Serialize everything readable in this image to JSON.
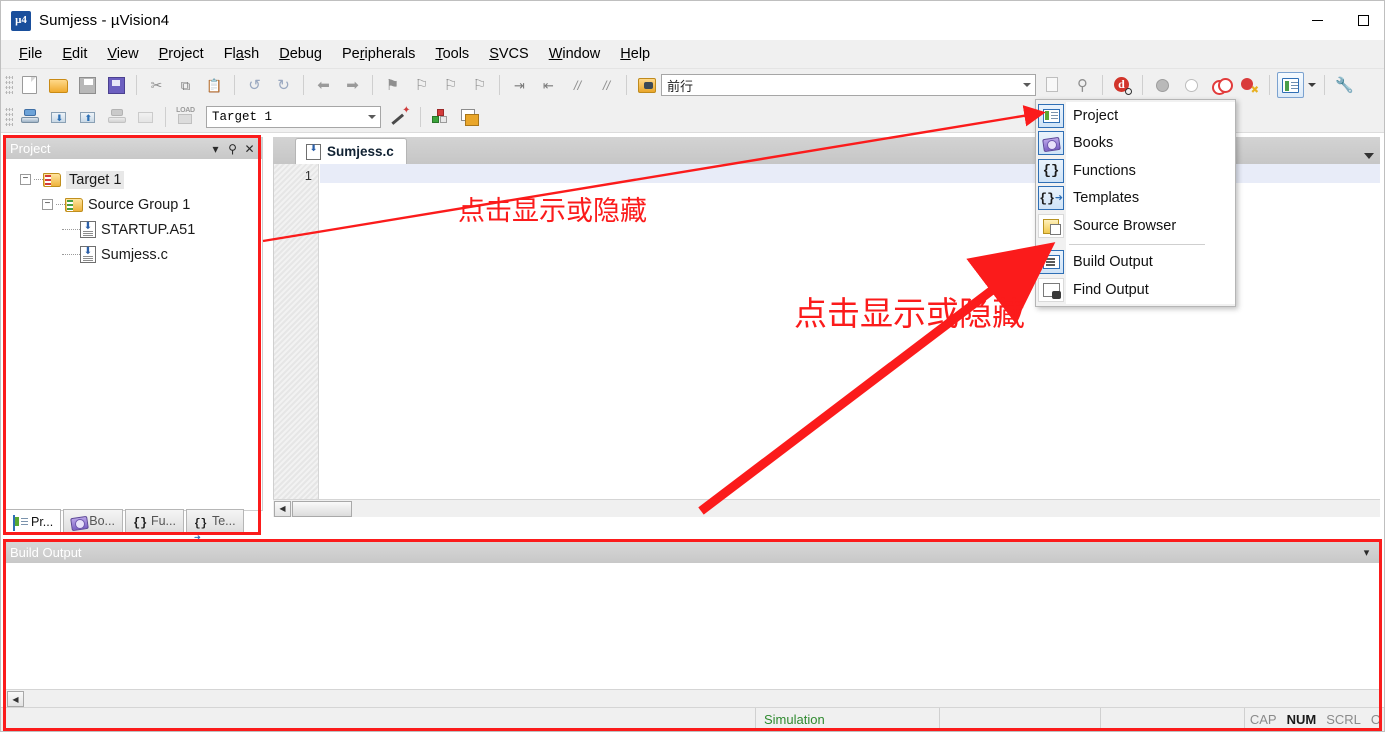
{
  "window": {
    "title": "Sumjess  - µVision4",
    "app_icon": "uvision-logo-icon",
    "minimize": "minimize-button",
    "maximize": "maximize-button"
  },
  "menubar": {
    "items": [
      {
        "label": "File",
        "accel": "F"
      },
      {
        "label": "Edit",
        "accel": "E"
      },
      {
        "label": "View",
        "accel": "V"
      },
      {
        "label": "Project",
        "accel": "P"
      },
      {
        "label": "Flash",
        "accel": "a"
      },
      {
        "label": "Debug",
        "accel": "D"
      },
      {
        "label": "Peripherals",
        "accel": "r"
      },
      {
        "label": "Tools",
        "accel": "T"
      },
      {
        "label": "SVCS",
        "accel": "S"
      },
      {
        "label": "Window",
        "accel": "W"
      },
      {
        "label": "Help",
        "accel": "H"
      }
    ]
  },
  "toolbar1": {
    "find_combo_value": "前行",
    "icons": [
      "new-file-icon",
      "open-file-icon",
      "save-icon",
      "save-all-icon",
      "cut-icon",
      "copy-icon",
      "paste-icon",
      "undo-icon",
      "redo-icon",
      "navigate-back-icon",
      "navigate-forward-icon",
      "bookmark-toggle-icon",
      "bookmark-prev-icon",
      "bookmark-next-icon",
      "bookmark-clear-icon",
      "indent-icon",
      "outdent-icon",
      "comment-icon",
      "uncomment-icon",
      "find-in-files-icon",
      "find-combo",
      "insert-file-icon",
      "find-next-icon",
      "debug-start-icon"
    ]
  },
  "toolbar2": {
    "target_combo_value": "Target 1",
    "icons": [
      "translate-icon",
      "build-icon",
      "rebuild-icon",
      "batch-build-icon",
      "stop-build-icon",
      "download-icon",
      "target-combo",
      "target-options-icon",
      "manage-components-icon",
      "manage-project-items-icon"
    ],
    "breakpoints": [
      "insert-breakpoint-icon",
      "kill-breakpoint-icon",
      "disable-breakpoint-icon",
      "kill-all-breakpoints-icon"
    ],
    "window_toggle": "window-toggle-icon",
    "window_toggle_arrow": "chevron-down-icon",
    "configuration": "configuration-wizard-icon"
  },
  "dropdown": {
    "visible": true,
    "groups": [
      {
        "items": [
          {
            "label": "Project",
            "icon": "project-window-icon",
            "selected": true
          },
          {
            "label": "Books",
            "icon": "books-window-icon",
            "selected": false
          },
          {
            "label": "Functions",
            "icon": "functions-window-icon",
            "selected": false
          },
          {
            "label": "Templates",
            "icon": "templates-window-icon",
            "selected": false
          },
          {
            "label": "Source Browser",
            "icon": "source-browser-icon",
            "selected": false
          }
        ]
      },
      {
        "items": [
          {
            "label": "Build Output",
            "icon": "build-output-icon",
            "selected": true
          },
          {
            "label": "Find Output",
            "icon": "find-output-icon",
            "selected": false
          }
        ]
      }
    ]
  },
  "project_panel": {
    "title": "Project",
    "header_buttons": [
      "chevron-down-icon",
      "pin-icon",
      "close-icon"
    ],
    "tree": [
      {
        "level": 0,
        "label": "Target 1",
        "icon": "target-folder-icon",
        "expander": "-",
        "selected": true
      },
      {
        "level": 1,
        "label": "Source Group 1",
        "icon": "source-group-folder-icon",
        "expander": "-",
        "selected": false
      },
      {
        "level": 2,
        "label": "STARTUP.A51",
        "icon": "source-file-icon",
        "expander": "",
        "selected": false
      },
      {
        "level": 2,
        "label": "Sumjess.c",
        "icon": "source-file-icon",
        "expander": "",
        "selected": false
      }
    ],
    "tabs": [
      {
        "label": "Pr...",
        "icon": "project-window-icon",
        "active": true
      },
      {
        "label": "Bo...",
        "icon": "books-window-icon",
        "active": false
      },
      {
        "label": "Fu...",
        "icon": "functions-window-icon",
        "active": false
      },
      {
        "label": "Te...",
        "icon": "templates-window-icon",
        "active": false
      }
    ]
  },
  "editor": {
    "tabs": [
      {
        "label": "Sumjess.c",
        "icon": "source-file-icon",
        "active": true
      }
    ],
    "line_numbers": [
      "1"
    ],
    "content": "",
    "overflow_arrow": "chevron-down-icon"
  },
  "build_output": {
    "title": "Build Output",
    "header_buttons": [
      "chevron-down-icon"
    ],
    "content": ""
  },
  "statusbar": {
    "left": "",
    "simulation": "Simulation",
    "cells": [
      "",
      ""
    ],
    "indicators": [
      {
        "label": "CAP",
        "on": false
      },
      {
        "label": "NUM",
        "on": true
      },
      {
        "label": "SCRL",
        "on": false
      },
      {
        "label": "O",
        "on": false
      }
    ]
  },
  "annotations": {
    "color": "#fb1b1b",
    "notes": [
      {
        "text": "点击显示或隐藏",
        "name": "annotation-text-toggle-project"
      },
      {
        "text": "点击显示或隐藏",
        "name": "annotation-text-toggle-build-output"
      }
    ],
    "boxes": [
      "project-panel-highlight",
      "build-output-panel-highlight"
    ],
    "arrows": [
      "arrow-to-project-menu-item",
      "arrow-to-build-output-menu-item"
    ]
  }
}
